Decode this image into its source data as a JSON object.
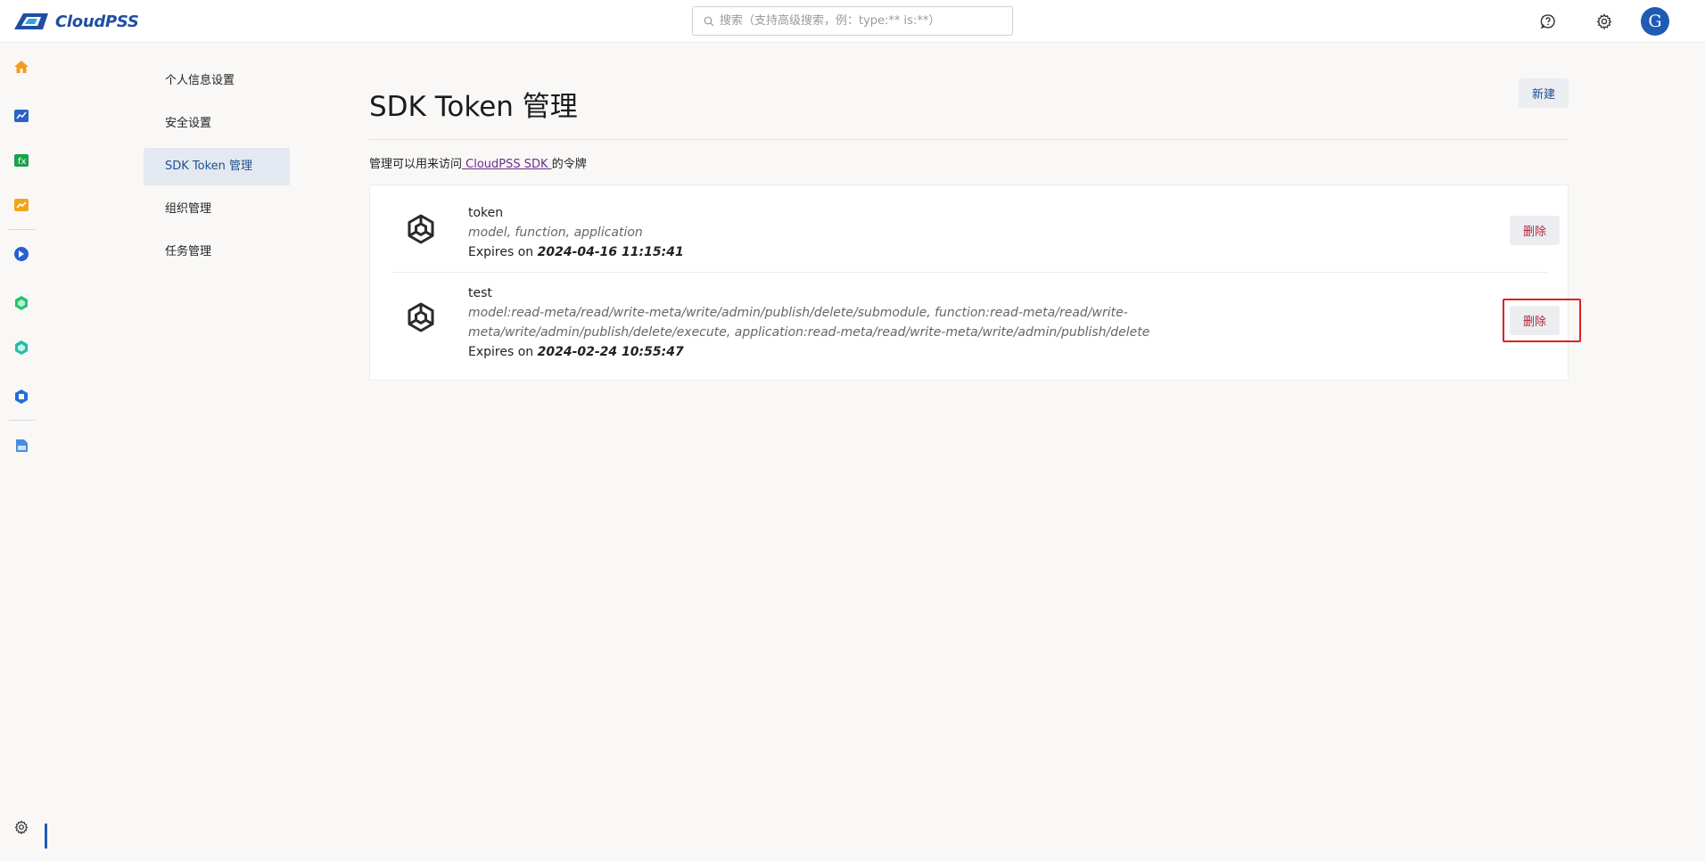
{
  "app": {
    "brand": "CloudPSS",
    "brand_color": "#1f4fa3"
  },
  "header": {
    "search_placeholder": "搜索（支持高级搜索，例：type:** is:**）",
    "icons": [
      "help-icon",
      "gear-icon"
    ],
    "avatar_letter": "G"
  },
  "rail": {
    "items": [
      "home-icon",
      "chart-icon",
      "function-icon",
      "trend-icon",
      "app-icon",
      "hex-icon",
      "hex-icon-2",
      "image-icon",
      "file-icon"
    ],
    "footer_icon": "gear-icon"
  },
  "settings_nav": {
    "items": [
      {
        "label": "个人信息设置",
        "active": false
      },
      {
        "label": "安全设置",
        "active": false
      },
      {
        "label": "SDK Token 管理",
        "active": true
      },
      {
        "label": "组织管理",
        "active": false
      },
      {
        "label": "任务管理",
        "active": false
      }
    ]
  },
  "main": {
    "title": "SDK Token 管理",
    "new_label": "新建",
    "desc_prefix": "管理可以用来访问",
    "desc_link": " CloudPSS SDK ",
    "desc_suffix": "的令牌",
    "expires_prefix": "Expires on ",
    "delete_label": "删除",
    "tokens": [
      {
        "name": "token",
        "scopes": "model, function, application",
        "expires": "2024-04-16 11:15:41"
      },
      {
        "name": "test",
        "scopes": "model:read-meta/read/write-meta/write/admin/publish/delete/submodule, function:read-meta/read/write-meta/write/admin/publish/delete/execute, application:read-meta/read/write-meta/write/admin/publish/delete",
        "expires": "2024-02-24 10:55:47"
      }
    ]
  },
  "colors": {
    "accent": "#1f5bb4",
    "danger": "#b3273b",
    "highlight": "#e02020"
  }
}
